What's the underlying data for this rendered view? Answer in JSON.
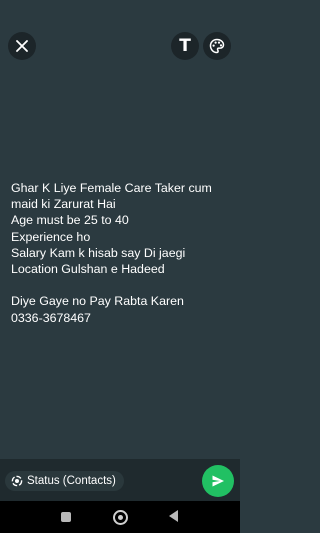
{
  "header": {
    "close_icon": "close-icon",
    "text_tool_label": "T",
    "palette_icon": "palette-icon"
  },
  "status": {
    "background_color": "#2b3a40",
    "lines": [
      "Ghar K Liye Female Care Taker cum",
      "maid ki Zarurat Hai",
      "Age must be 25 to 40",
      "Experience ho",
      "Salary Kam k hisab say Di jaegi",
      "Location Gulshan e Hadeed",
      "",
      "Diye Gaye no Pay Rabta Karen",
      "0336-3678467"
    ]
  },
  "footer": {
    "audience_label": "Status (Contacts)",
    "audience_icon": "status-icon",
    "send_icon": "send-icon",
    "send_color": "#21c063"
  },
  "navbar": {
    "recent_icon": "recent-apps-icon",
    "home_icon": "home-icon",
    "back_icon": "back-icon"
  }
}
